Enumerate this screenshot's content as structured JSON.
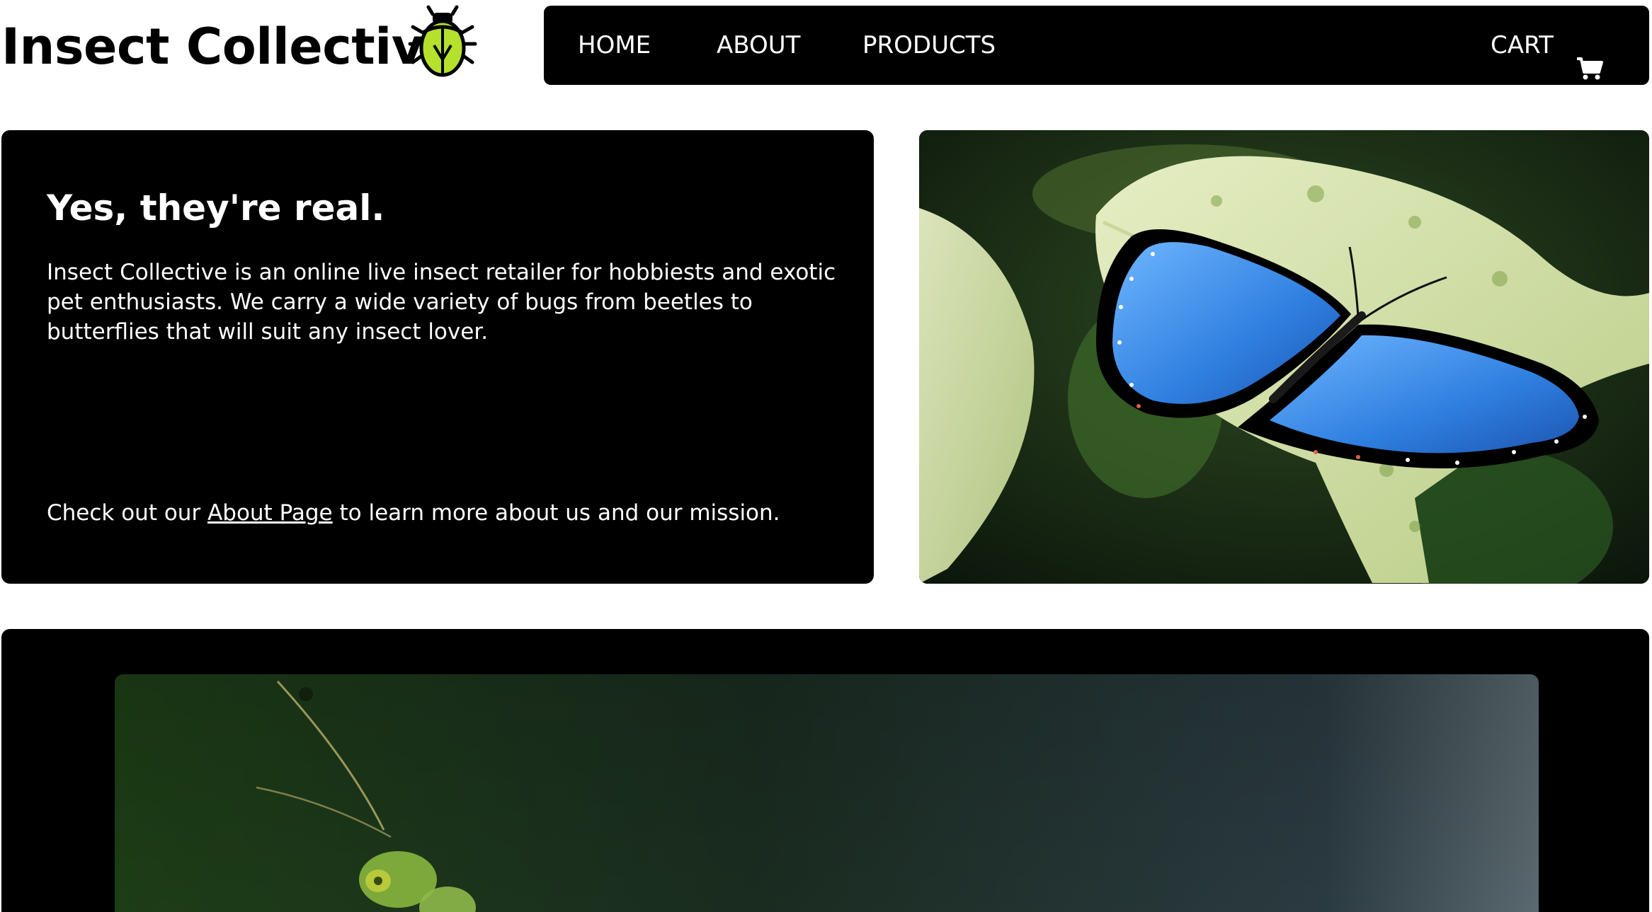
{
  "brand": {
    "name": "Insect Collective",
    "logo_icon": "beetle-logo-icon",
    "logo_color": "#b5e02c"
  },
  "nav": {
    "items": [
      {
        "label": "HOME"
      },
      {
        "label": "ABOUT"
      },
      {
        "label": "PRODUCTS"
      }
    ],
    "cart_label": "CART",
    "cart_icon": "shopping-cart-icon"
  },
  "hero": {
    "title": "Yes, they're real.",
    "body": "Insect Collective is an online live insect retailer for hobbiests and exotic pet enthusiasts. We carry a wide variety of bugs from beetles to butterflies that will suit any insect lover.",
    "cta_before": "Check out our ",
    "cta_link": "About Page",
    "cta_after": " to learn more about us and our mission.",
    "image_subject": "blue-morpho-butterfly-on-leaf"
  },
  "feature": {
    "image_subject": "green-insect-on-dark-background"
  },
  "colors": {
    "background": "#ffffff",
    "card": "#000000",
    "text_on_dark": "#ffffff",
    "accent": "#b5e02c"
  }
}
